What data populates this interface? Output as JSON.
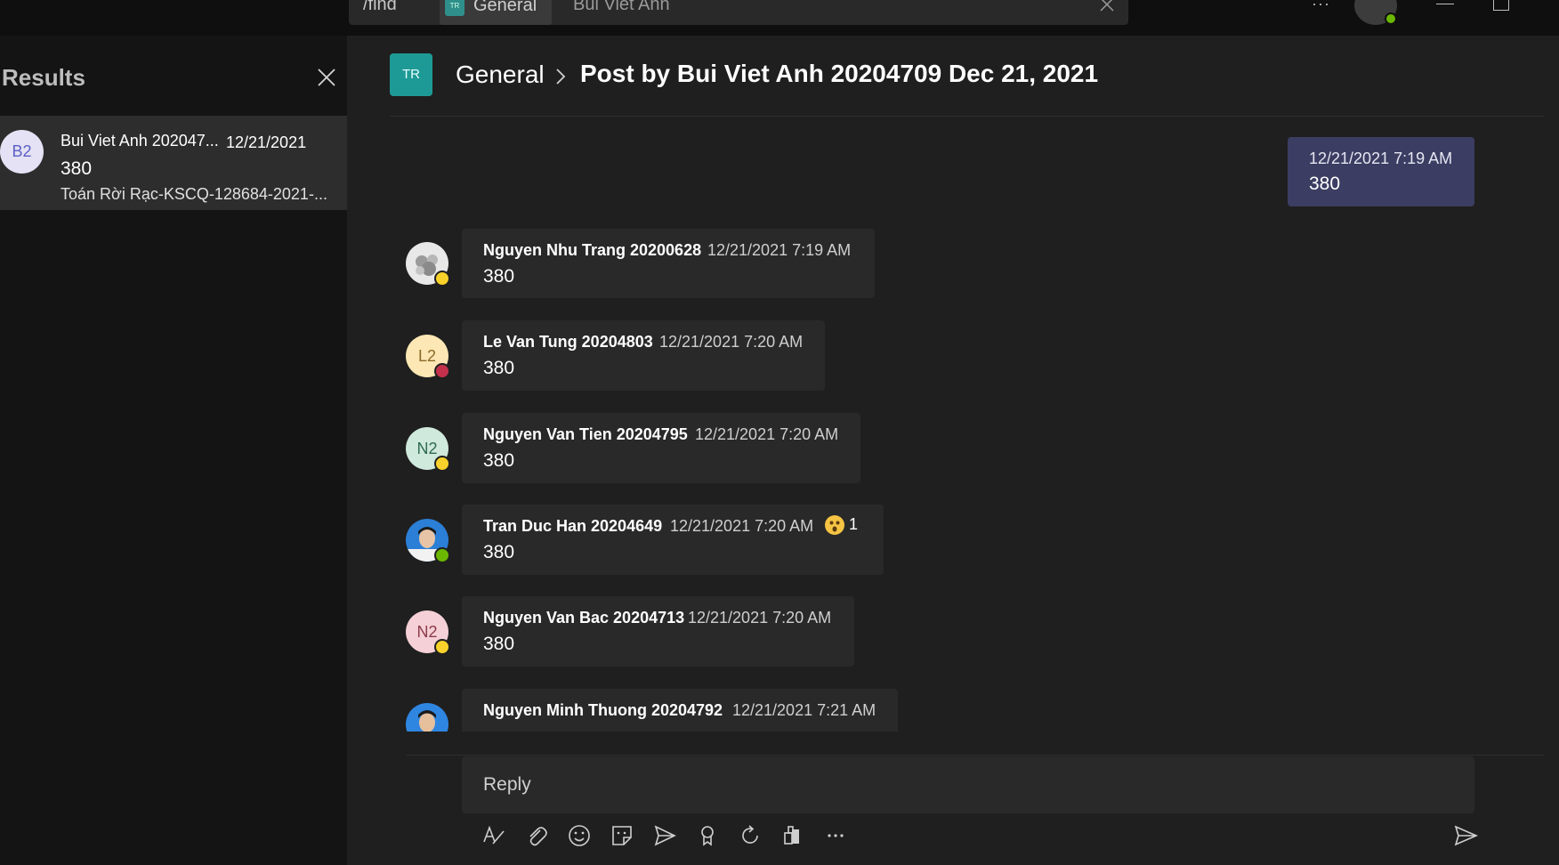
{
  "topbar": {
    "command": "/find",
    "tab_channel": "General",
    "tab_channel_avatar": "TR",
    "tab_person": "Bui Viet Anh",
    "more_icon": "more-horizontal-icon"
  },
  "search_panel": {
    "title": "Results",
    "results": [
      {
        "initials": "B2",
        "name": "Bui Viet Anh 202047...",
        "date": "12/21/2021",
        "body": "380",
        "subtitle": "Toán Rời Rạc-KSCQ-128684-2021-..."
      }
    ]
  },
  "header": {
    "avatar": "TR",
    "channel": "General",
    "post_title": "Post by Bui Viet Anh 20204709 Dec 21, 2021"
  },
  "own_message": {
    "time": "12/21/2021 7:19 AM",
    "text": "380"
  },
  "messages": [
    {
      "name": "Nguyen Nhu Trang 20200628",
      "time": "12/21/2021 7:19 AM",
      "text": "380",
      "avatar": "photo",
      "status": "away"
    },
    {
      "name": "Le Van Tung 20204803",
      "time": "12/21/2021 7:20 AM",
      "text": "380",
      "initials": "L2",
      "avatar_color": "#fde7b4",
      "initials_color": "#8a6a2a",
      "status": "busy"
    },
    {
      "name": "Nguyen Van Tien 20204795",
      "time": "12/21/2021 7:20 AM",
      "text": "380",
      "initials": "N2",
      "avatar_color": "#cfe9dc",
      "initials_color": "#2f6b4f",
      "status": "away"
    },
    {
      "name": "Tran Duc Han 20204649",
      "time": "12/21/2021 7:20 AM",
      "text": "380",
      "avatar": "photo",
      "status": "available",
      "reaction": {
        "emoji": "surprised-emoji-icon",
        "count": "1"
      }
    },
    {
      "name": "Nguyen Van Bac 20204713",
      "time": "12/21/2021 7:20 AM",
      "text": "380",
      "initials": "N2",
      "avatar_color": "#f5d0d6",
      "initials_color": "#8c3b4a",
      "status": "away"
    },
    {
      "name": "Nguyen Minh Thuong 20204792",
      "time": "12/21/2021 7:21 AM",
      "text": "",
      "avatar": "photo"
    }
  ],
  "compose": {
    "placeholder": "Reply",
    "tools": [
      "format-icon",
      "attach-icon",
      "emoji-icon",
      "sticker-icon",
      "schedule-send-icon",
      "praise-icon",
      "loop-icon",
      "apps-icon",
      "more-options-icon"
    ],
    "send": "send-icon"
  }
}
